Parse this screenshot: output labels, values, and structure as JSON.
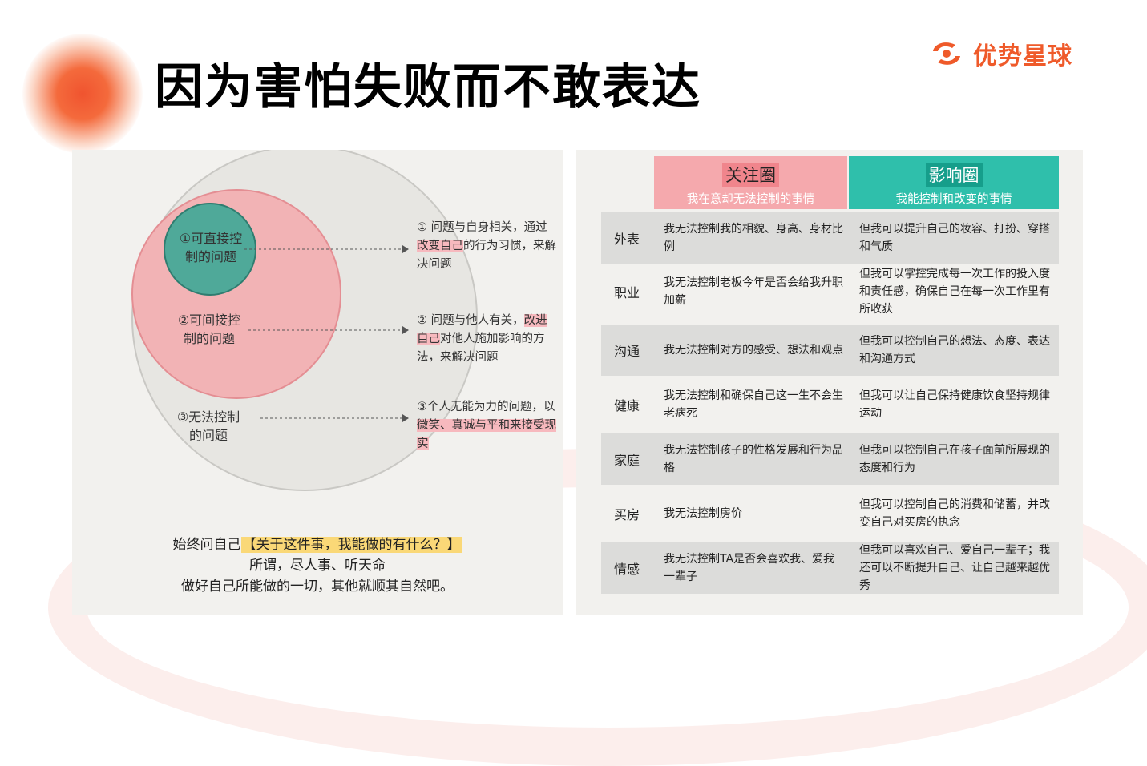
{
  "title": "因为害怕失败而不敢表达",
  "brand": {
    "name": "优势星球",
    "accent": "#ef5a2a"
  },
  "circles": {
    "inner_label": [
      "①可直接控",
      "制的问题"
    ],
    "middle_label": [
      "②可间接控",
      "制的问题"
    ],
    "outer_label": [
      "③无法控制",
      "的问题"
    ],
    "desc1": {
      "pre": "① 问题与自身相关，通过",
      "hl": "改变自己",
      "post": "的行为习惯，来解决问题"
    },
    "desc2": {
      "pre": "② 问题与他人有关，",
      "hl": "改进自己",
      "post": "对他人施加影响的方法，来解决问题"
    },
    "desc3": {
      "pre": "③个人无能为力的问题，以",
      "hl": "微笑、真诚与平和来接受现实",
      "post": ""
    },
    "colors": {
      "outer": "#e7e6e2",
      "middle": "#f2b3b5",
      "inner": "#4fa999"
    }
  },
  "bottom": {
    "line1_pre": "始终问自己",
    "line1_hl": "【关于这件事，我能做的有什么？】",
    "line2": "所谓，尽人事、听天命",
    "line3": "做好自己所能做的一切，其他就顺其自然吧。"
  },
  "table": {
    "attention": {
      "title": "关注圈",
      "subtitle": "我在意却无法控制的事情"
    },
    "influence": {
      "title": "影响圈",
      "subtitle": "我能控制和改变的事情"
    },
    "rows": [
      {
        "cat": "外表",
        "attention": "我无法控制我的相貌、身高、身材比例",
        "influence": "但我可以提升自己的妆容、打扮、穿搭和气质"
      },
      {
        "cat": "职业",
        "attention": "我无法控制老板今年是否会给我升职加薪",
        "influence": "但我可以掌控完成每一次工作的投入度和责任感，确保自己在每一次工作里有所收获"
      },
      {
        "cat": "沟通",
        "attention": "我无法控制对方的感受、想法和观点",
        "influence": "但我可以控制自己的想法、态度、表达和沟通方式"
      },
      {
        "cat": "健康",
        "attention": "我无法控制和确保自己这一生不会生老病死",
        "influence": "但我可以让自己保持健康饮食坚持规律运动"
      },
      {
        "cat": "家庭",
        "attention": "我无法控制孩子的性格发展和行为品格",
        "influence": "但我可以控制自己在孩子面前所展现的态度和行为"
      },
      {
        "cat": "买房",
        "attention": "我无法控制房价",
        "influence": "但我可以控制自己的消费和储蓄，并改变自己对买房的执念"
      },
      {
        "cat": "情感",
        "attention": "我无法控制TA是否会喜欢我、爱我一辈子",
        "influence": "但我可以喜欢自己、爱自己一辈子；我还可以不断提升自己、让自己越来越优秀"
      }
    ]
  }
}
